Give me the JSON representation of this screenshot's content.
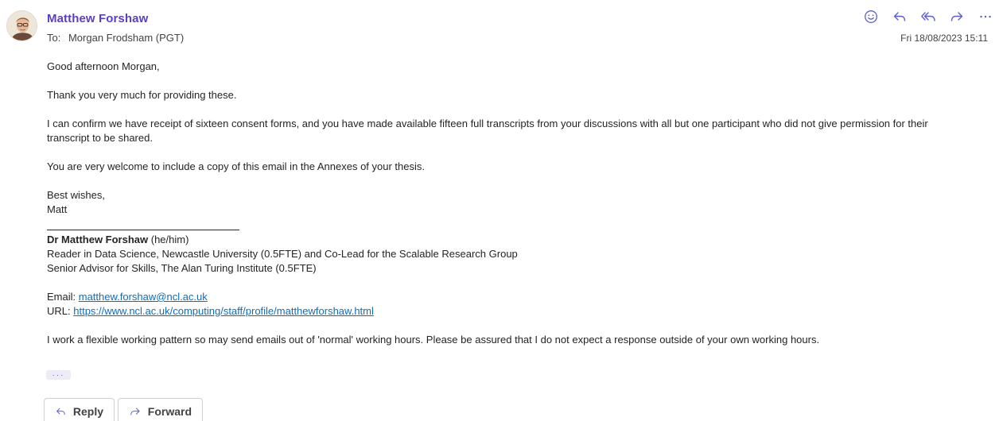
{
  "header": {
    "sender_name": "Matthew Forshaw",
    "to_label": "To:",
    "recipient": "Morgan Frodsham (PGT)",
    "date": "Fri 18/08/2023 15:11"
  },
  "actions": {
    "icons": [
      "emoji-react-icon",
      "reply-icon",
      "reply-all-icon",
      "forward-icon",
      "more-icon"
    ]
  },
  "body": {
    "greeting": "Good afternoon Morgan,",
    "thanks": "Thank you very much for providing these.",
    "confirm_line1": "I can confirm we have receipt of sixteen consent forms, and you have made available fifteen full transcripts from your discussions with all but one participant who did not give permission for their",
    "confirm_line2": "transcript to be shared.",
    "annex": "You are very welcome to include a copy of this email in the Annexes of your thesis.",
    "signoff": "Best wishes,",
    "name_short": "Matt"
  },
  "signature": {
    "name": "Dr Matthew Forshaw",
    "pronouns": " (he/him)",
    "role1": "Reader in Data Science, Newcastle University (0.5FTE) and Co-Lead for the Scalable Research Group",
    "role2": "Senior Advisor for Skills, The Alan Turing Institute (0.5FTE)",
    "email_label": "Email: ",
    "email": "matthew.forshaw@ncl.ac.uk",
    "url_label": "URL: ",
    "url": "https://www.ncl.ac.uk/computing/staff/profile/matthewforshaw.html",
    "note": "I work a flexible working pattern so may send emails out of 'normal' working hours.  Please be assured that I do not expect a response outside of your own working hours."
  },
  "footer": {
    "more_dots": "···",
    "reply_label": "Reply",
    "forward_label": "Forward"
  },
  "colors": {
    "sender": "#5b3fbf",
    "accent": "#5b5fc7",
    "link": "#0f6cbd"
  }
}
